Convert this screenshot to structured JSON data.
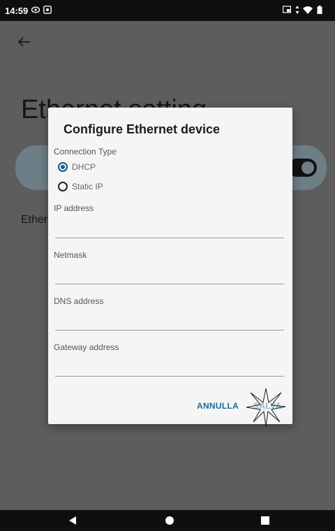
{
  "status_bar": {
    "time": "14:59",
    "left_icons": [
      "eye-icon",
      "app-notification-icon"
    ],
    "right_icons": [
      "cast-icon",
      "data-transfer-icon",
      "wifi-icon",
      "battery-icon"
    ]
  },
  "background_screen": {
    "title": "Ethernet setting",
    "section_label": "Ether",
    "toggle_on": true
  },
  "dialog": {
    "title": "Configure Ethernet device",
    "connection_type_label": "Connection Type",
    "options": [
      {
        "label": "DHCP",
        "selected": true
      },
      {
        "label": "Static IP",
        "selected": false
      }
    ],
    "fields": [
      {
        "label": "IP address",
        "value": ""
      },
      {
        "label": "Netmask",
        "value": ""
      },
      {
        "label": "DNS address",
        "value": ""
      },
      {
        "label": "Gateway address",
        "value": ""
      }
    ],
    "cancel_label": "ANNULLA",
    "save_label": "SALVA"
  },
  "colors": {
    "accent": "#0d5a80",
    "button_text": "#1f6f8f",
    "disabled_button_text": "#8fb9cf",
    "dialog_bg": "#f5f5f5"
  },
  "nav_bar": {
    "icons": [
      "back-triangle-icon",
      "home-circle-icon",
      "recents-square-icon"
    ]
  }
}
